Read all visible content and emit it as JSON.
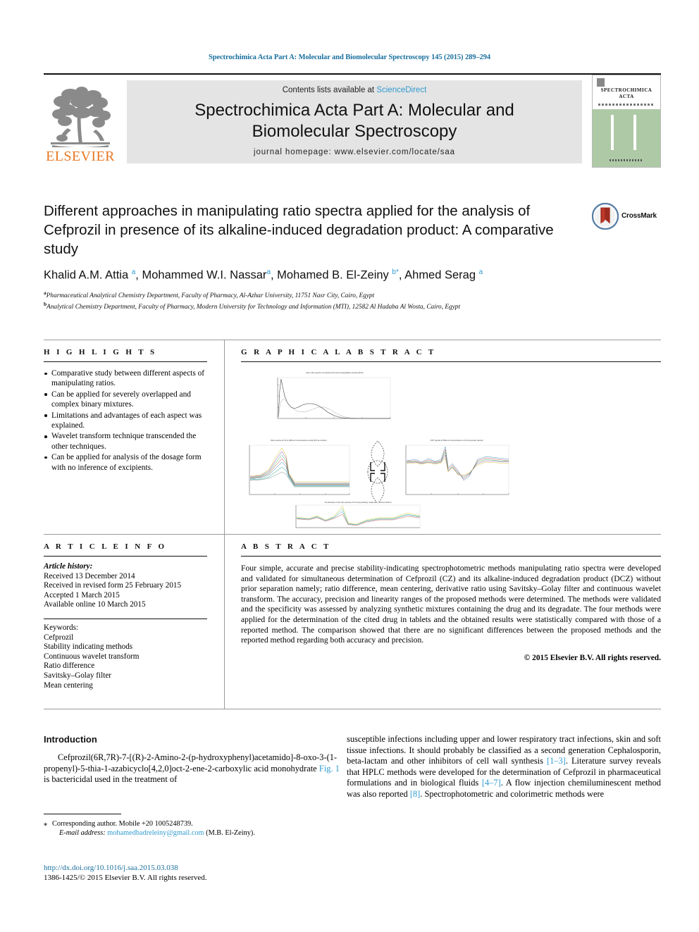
{
  "running_head": "Spectrochimica Acta Part A: Molecular and Biomolecular Spectroscopy 145 (2015) 289–294",
  "masthead": {
    "publisher_wordmark": "ELSEVIER",
    "contents_prefix": "Contents lists available at ",
    "contents_link": "ScienceDirect",
    "journal_title_line1": "Spectrochimica Acta Part A: Molecular and",
    "journal_title_line2": "Biomolecular Spectroscopy",
    "homepage": "journal homepage: www.elsevier.com/locate/saa",
    "cover_title_line1": "SPECTROCHIMICA",
    "cover_title_line2": "ACTA",
    "accent_orange": "#E87722",
    "accent_blue": "#2e9ad0",
    "band_gray": "#e4e4e4",
    "cover_green": "#aec9a6"
  },
  "article": {
    "title": "Different approaches in manipulating ratio spectra applied for the analysis of Cefprozil in presence of its alkaline-induced degradation product: A comparative study",
    "crossmark_label": "CrossMark",
    "authors_html": "Khalid A.M. Attia <sup>a</sup>, Mohammed W.I. Nassar<sup>a</sup>, Mohamed B. El-Zeiny <sup>b</sup><sup>*</sup>, Ahmed Serag <sup>a</sup>",
    "affiliation_a": "Pharmaceutical Analytical Chemistry Department, Faculty of Pharmacy, Al-Azhar University, 11751 Nasr City, Cairo, Egypt",
    "affiliation_b": "Analytical Chemistry Department, Faculty of Pharmacy, Modern University for Technology and Information (MTI), 12582 Al Hadaba Al Wosta, Cairo, Egypt",
    "affil_marker_a": "a",
    "affil_marker_b": "b"
  },
  "highlights": {
    "heading": "H I G H L I G H T S",
    "items": [
      "Comparative study between different aspects of manipulating ratios.",
      "Can be applied for severely overlapped and complex binary mixtures.",
      "Limitations and advantages of each aspect was explained.",
      "Wavelet transform technique transcended the other techniques.",
      "Can be applied for analysis of the dosage form with no inference of excipients."
    ]
  },
  "graphical_abstract": {
    "heading": "G R A P H I C A L   A B S T R A C T",
    "panels": [
      {
        "id": "top-spectra",
        "title": "Zero order spectra of Cefprozil (CZ) and its degradation product (DCZ)"
      },
      {
        "id": "left-ratio",
        "title": "Ratio spectra of CZ at different concentrations using DCZ as a divisor"
      },
      {
        "id": "right-cwt",
        "title": "CWT signals of different concentrations of CZ using Haar wavelet"
      },
      {
        "id": "bottom-derivative",
        "title": "1st derivative of the ratio spectra of CZ using Savitsky–Golay filter (DCZ as divisor)"
      }
    ]
  },
  "article_info": {
    "heading": "A R T I C L E    I N F O",
    "history_label": "Article history:",
    "history": [
      "Received 13 December 2014",
      "Received in revised form 25 February 2015",
      "Accepted 1 March 2015",
      "Available online 10 March 2015"
    ],
    "keywords_label": "Keywords:",
    "keywords": [
      "Cefprozil",
      "Stability indicating methods",
      "Continuous wavelet transform",
      "Ratio difference",
      "Savitsky–Golay filter",
      "Mean centering"
    ]
  },
  "abstract": {
    "heading": "A B S T R A C T",
    "text": "Four simple, accurate and precise stability-indicating spectrophotometric methods manipulating ratio spectra were developed and validated for simultaneous determination of Cefprozil (CZ) and its alkaline-induced degradation product (DCZ) without prior separation namely; ratio difference, mean centering, derivative ratio using Savitsky–Golay filter and continuous wavelet transform. The accuracy, precision and linearity ranges of the proposed methods were determined. The methods were validated and the specificity was assessed by analyzing synthetic mixtures containing the drug and its degradate. The four methods were applied for the determination of the cited drug in tablets and the obtained results were statistically compared with those of a reported method. The comparison showed that there are no significant differences between the proposed methods and the reported method regarding both accuracy and precision.",
    "copyright": "© 2015 Elsevier B.V. All rights reserved."
  },
  "body": {
    "section_heading": "Introduction",
    "left_paragraph_pre": "Cefprozil(6R,7R)-7-[(R)-2-Amino-2-(p-hydroxyphenyl)acetamido]-8-oxo-3-(1-propenyl)-5-thia-1-azabicyclo[4,2,0]oct-2-ene-2-carboxylic acid monohydrate ",
    "left_fig_link": "Fig. 1",
    "left_paragraph_post": " is bactericidal used in the treatment of",
    "right_paragraph_1": "susceptible infections including upper and lower respiratory tract infections, skin and soft tissue infections. It should probably be classified as a second generation Cephalosporin, beta-lactam and other inhibitors of cell wall synthesis ",
    "right_ref_1": "[1–3]",
    "right_paragraph_2": ". Literature survey reveals that HPLC methods were developed for the determination of Cefprozil in pharmaceutical formulations and in biological fluids ",
    "right_ref_2": "[4–7]",
    "right_paragraph_3": ". A flow injection chemiluminescent method was also reported ",
    "right_ref_3": "[8]",
    "right_paragraph_4": ". Spectrophotometric and colorimetric methods were"
  },
  "footnote": {
    "star": "⁎",
    "corresponding": "Corresponding author. Mobile +20 1005248739.",
    "email_label": "E-mail address:",
    "email": "mohamedbadreleiny@gmail.com",
    "email_owner": "(M.B. El-Zeiny)."
  },
  "footer": {
    "doi": "http://dx.doi.org/10.1016/j.saa.2015.03.038",
    "issn_copyright": "1386-1425/© 2015 Elsevier B.V. All rights reserved."
  }
}
